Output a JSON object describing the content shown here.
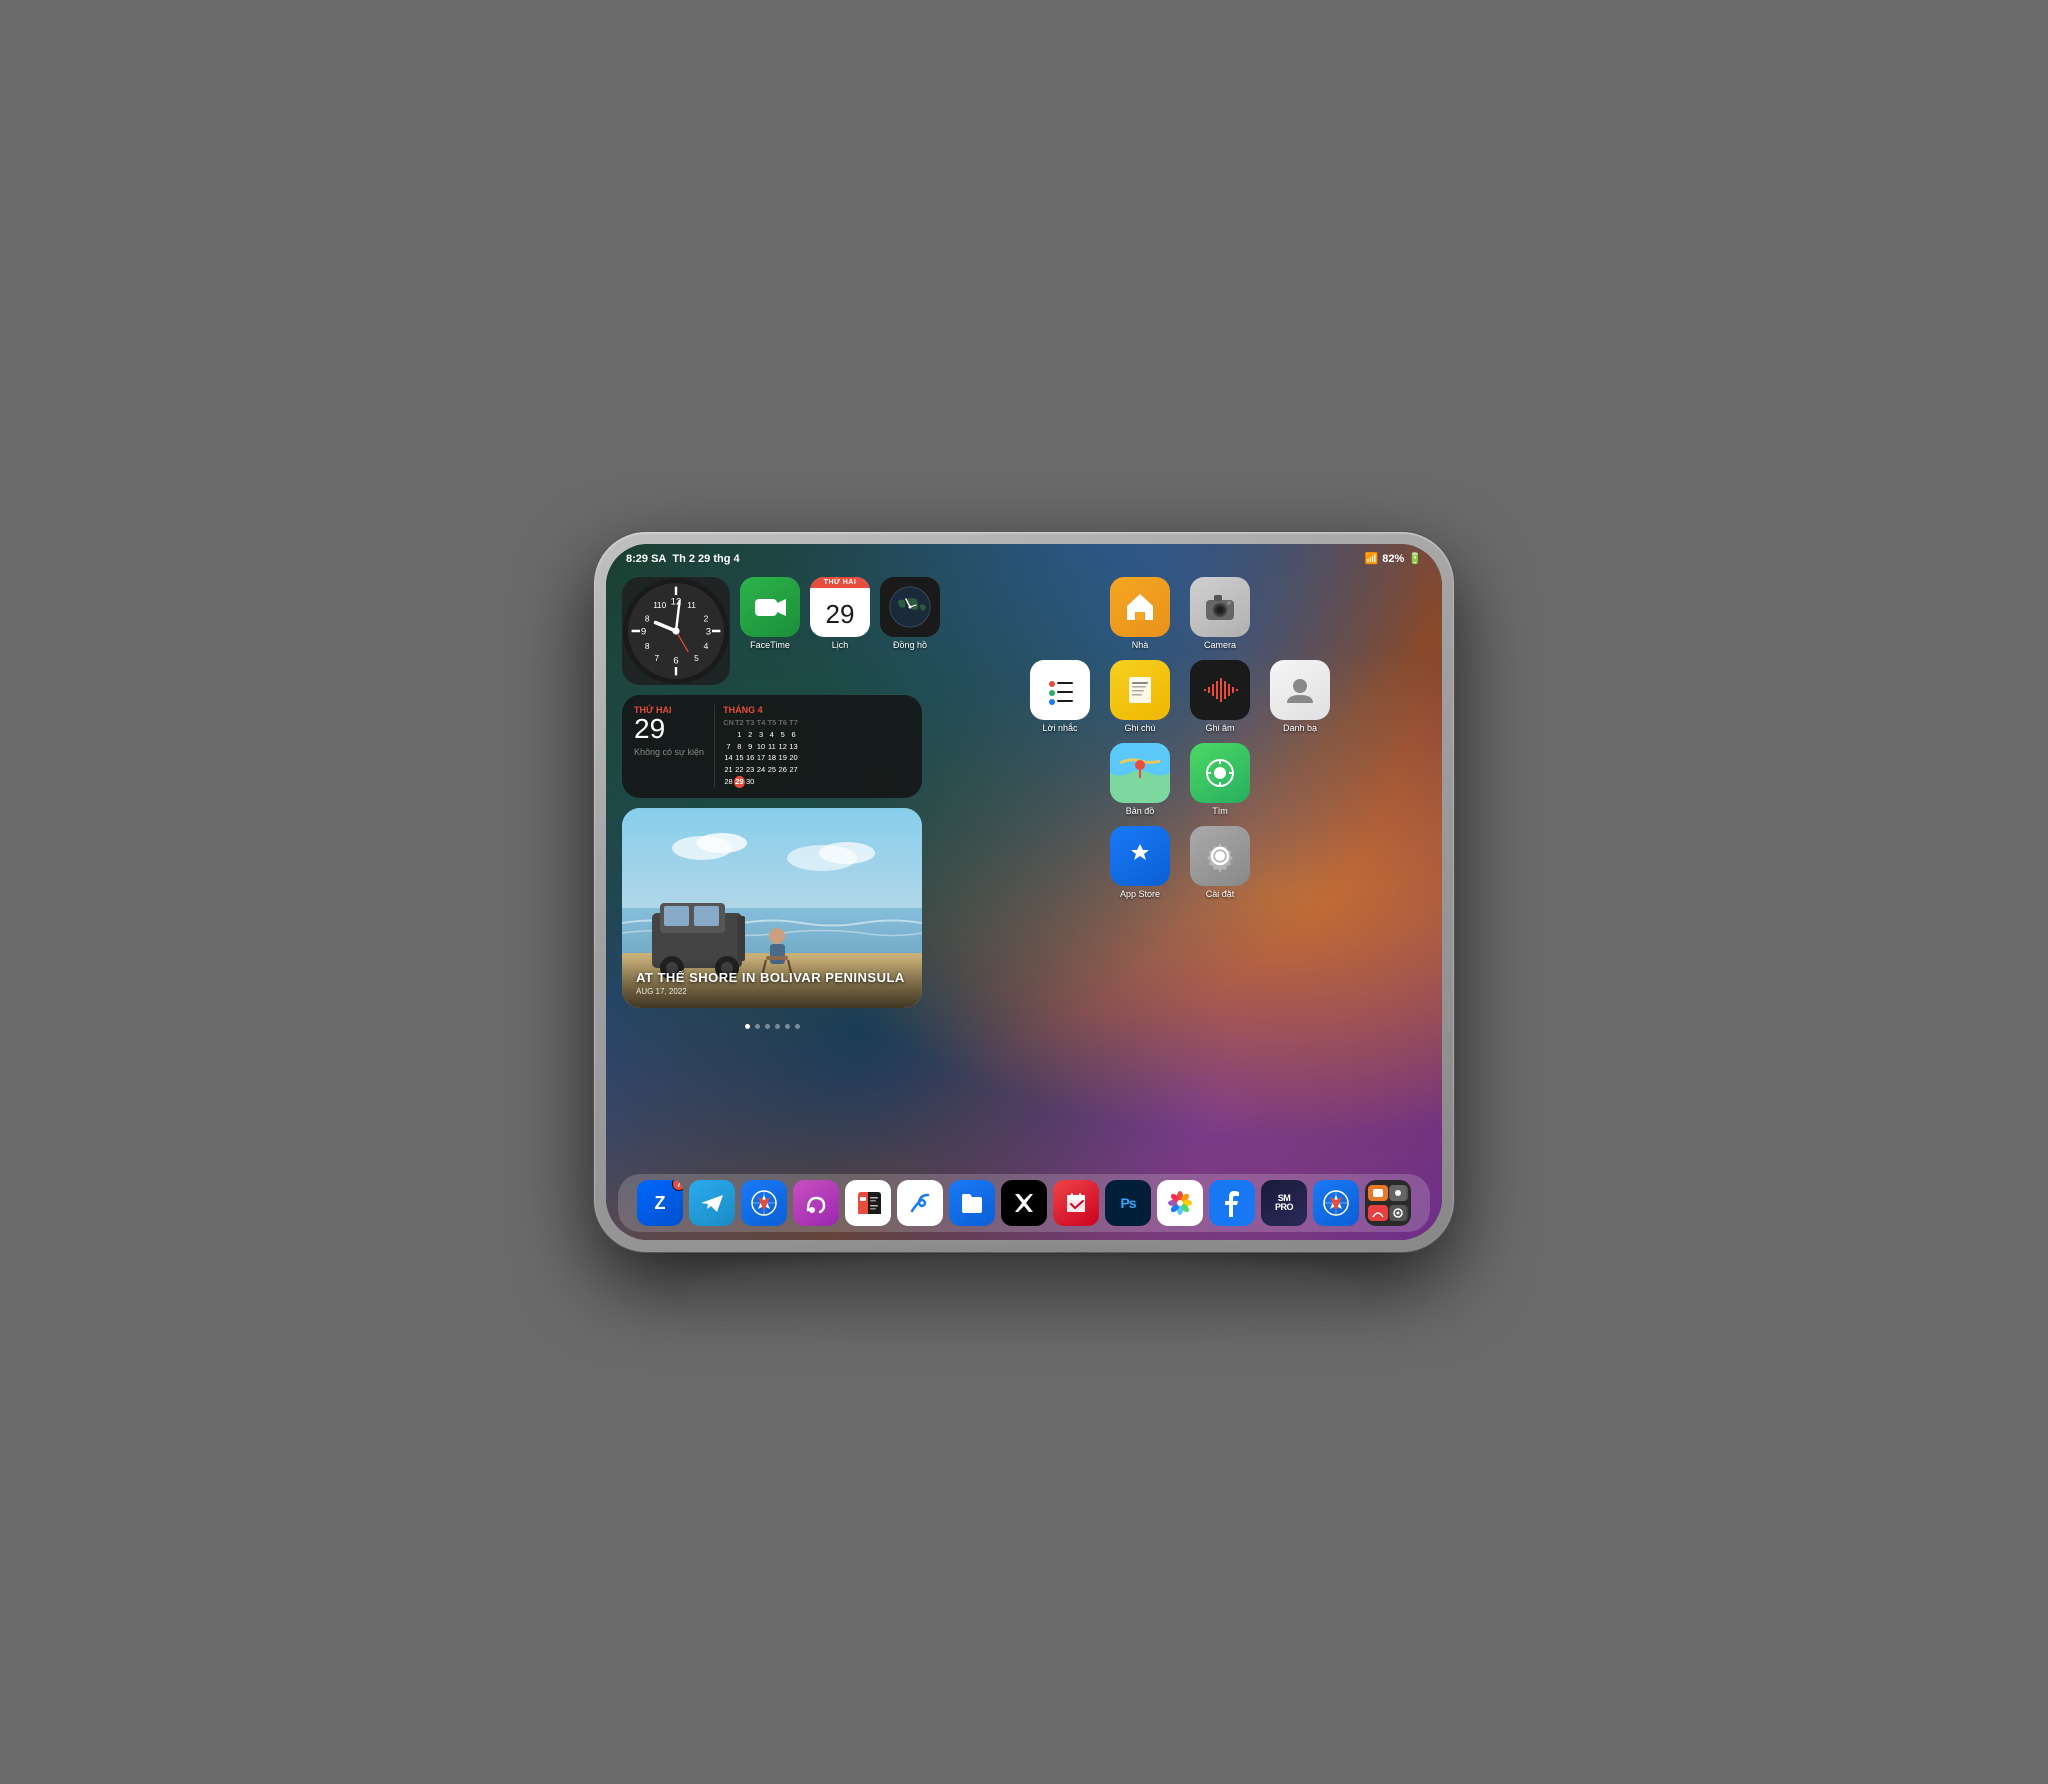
{
  "device": {
    "type": "iPad"
  },
  "statusBar": {
    "time": "8:29 SA",
    "date": "Th 2 29 thg 4",
    "wifi": "WiFi",
    "battery": "82%"
  },
  "widgets": {
    "clock": {
      "label": "Đồng hồ"
    },
    "calendar": {
      "dayName": "THỨ HAI",
      "dayNum": "29",
      "monthLabel": "THÁNG 4",
      "noEvent": "Không có sự kiện",
      "headers": [
        "CN",
        "T2",
        "T3",
        "T4",
        "T5",
        "T6",
        "T7"
      ],
      "rows": [
        [
          "",
          "1",
          "2",
          "3",
          "4",
          "5",
          "6"
        ],
        [
          "7",
          "8",
          "9",
          "10",
          "11",
          "12",
          "13"
        ],
        [
          "14",
          "15",
          "16",
          "17",
          "18",
          "19",
          "20"
        ],
        [
          "21",
          "22",
          "23",
          "24",
          "25",
          "26",
          "27"
        ],
        [
          "28",
          "29",
          "30",
          "",
          "",
          "",
          ""
        ]
      ]
    },
    "photo": {
      "title": "AT THẾ SHORE IN BOLIVAR PENINSULA",
      "date": "AUG 17, 2022"
    },
    "pageDots": 6,
    "activePageDot": 0
  },
  "topApps": [
    {
      "label": "FaceTime",
      "iconClass": "facetime-icon",
      "emoji": "📹"
    },
    {
      "label": "Lịch",
      "iconClass": "calendar-icon",
      "header": "THỨ HAI",
      "day": "29"
    },
    {
      "label": "Đồng hồ",
      "iconClass": "wc-icon"
    }
  ],
  "rightApps": [
    [
      {
        "label": "Nhà",
        "iconClass": "icon-home",
        "emoji": "🏠"
      },
      {
        "label": "Camera",
        "iconClass": "icon-camera",
        "emoji": "📷"
      }
    ],
    [
      {
        "label": "Lời nhắc",
        "iconClass": "icon-reminders",
        "emoji": "📋"
      },
      {
        "label": "Ghi chú",
        "iconClass": "icon-notes",
        "emoji": "📝"
      },
      {
        "label": "Ghi âm",
        "iconClass": "icon-voice-memos"
      },
      {
        "label": "Danh bạ",
        "iconClass": "icon-contacts",
        "emoji": "👤"
      }
    ],
    [
      {
        "label": "Bản đồ",
        "iconClass": "icon-maps"
      },
      {
        "label": "Tìm",
        "iconClass": "icon-find-my"
      }
    ],
    [
      {
        "label": "App Store",
        "iconClass": "icon-app-store"
      },
      {
        "label": "Cài đặt",
        "iconClass": "icon-settings"
      }
    ]
  ],
  "dock": [
    {
      "id": "zalo",
      "iconClass": "icon-telegram",
      "badge": "7",
      "color": "#0068ff"
    },
    {
      "id": "telegram",
      "iconClass": "icon-telegram",
      "color": "#2aabee"
    },
    {
      "id": "safari",
      "iconClass": "icon-safari",
      "color": "#1a7af8"
    },
    {
      "id": "mercury",
      "iconClass": "icon-mercury"
    },
    {
      "id": "news",
      "iconClass": "icon-news",
      "color": "#f5f5f5"
    },
    {
      "id": "freeform",
      "iconClass": "icon-freeform"
    },
    {
      "id": "files",
      "iconClass": "icon-files"
    },
    {
      "id": "x",
      "iconClass": "icon-x"
    },
    {
      "id": "fantastical",
      "iconClass": "icon-fantastical"
    },
    {
      "id": "ps",
      "iconClass": "icon-ps"
    },
    {
      "id": "photos",
      "iconClass": "icon-photos"
    },
    {
      "id": "facebook",
      "iconClass": "icon-facebook"
    },
    {
      "id": "smpro",
      "iconClass": "icon-smpro"
    },
    {
      "id": "safari2",
      "iconClass": "icon-safari2"
    },
    {
      "id": "multi",
      "iconClass": "icon-multi"
    }
  ],
  "colors": {
    "accent": "#e74c3c",
    "blue": "#1a7af8",
    "dock_bg": "rgba(255,255,255,0.18)"
  }
}
